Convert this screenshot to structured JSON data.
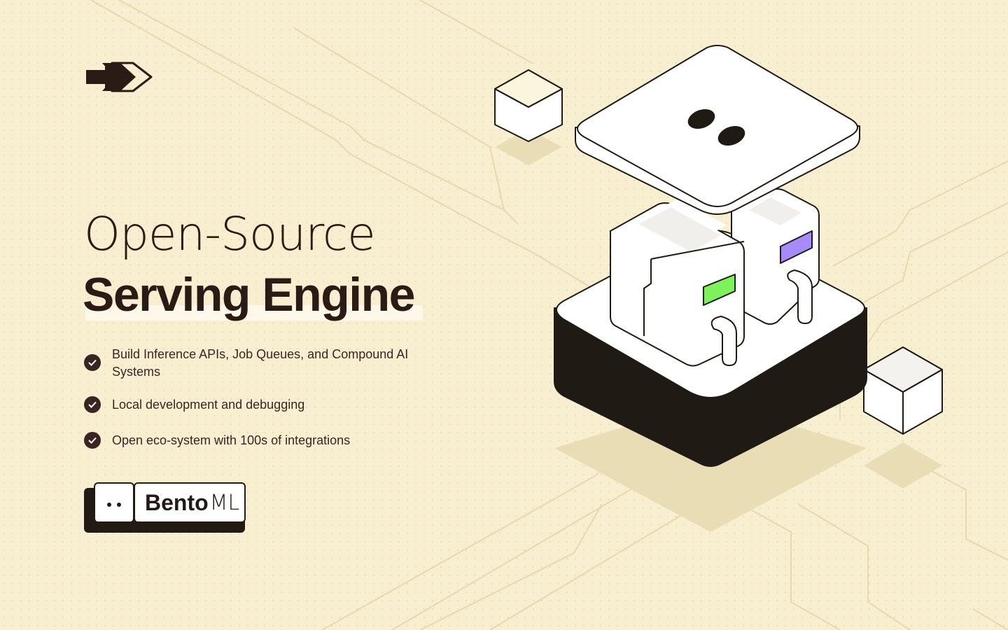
{
  "hero": {
    "title_line1": "Open-Source",
    "title_line2": "Serving Engine"
  },
  "features": [
    "Build Inference APIs, Job Queues, and Compound AI Systems",
    "Local development and debugging",
    "Open eco-system with 100s of integrations"
  ],
  "brand": {
    "name_bold": "Bento",
    "name_light": "ML"
  },
  "icons": {
    "logo": "double-arrow-icon",
    "check": "check-circle-icon"
  },
  "colors": {
    "background": "#f8efd1",
    "text": "#2a1b14",
    "accent_green": "#7ef25a",
    "accent_purple": "#a78bfa",
    "cube_cream": "#fbf5dd"
  }
}
